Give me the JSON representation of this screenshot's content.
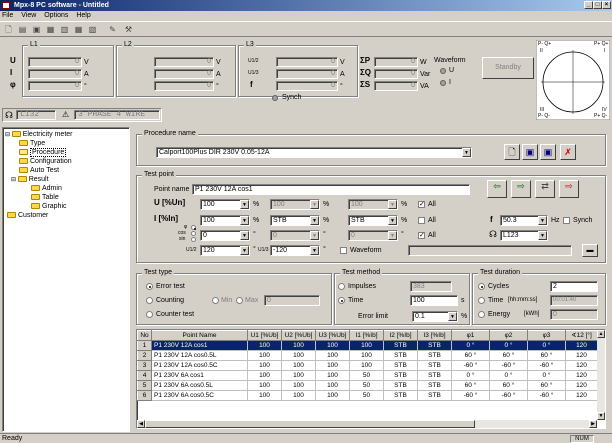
{
  "window": {
    "title": "Mpx-8 PC software - Untitled"
  },
  "menu": [
    "File",
    "View",
    "Options",
    "Help"
  ],
  "meter": {
    "L1": "L1",
    "L2": "L2",
    "L3": "L3",
    "row_labels": [
      "U",
      "I",
      "φ"
    ],
    "units": [
      "V",
      "A",
      "°"
    ],
    "zero": "0",
    "sum_labels": [
      "ΣP",
      "ΣQ",
      "ΣS"
    ],
    "sum_units": [
      "W",
      "Var",
      "VA"
    ],
    "mid_labels": [
      "U1/2",
      "U1/3",
      "f"
    ],
    "mid_units": [
      "°",
      "°",
      "Hz"
    ],
    "synch": "Synch",
    "waveform": "Waveform",
    "wave_u": "U",
    "wave_i": "I",
    "standby": "Standby",
    "phase_seq": "L132",
    "mode": "3 PHASE 4 WIRE",
    "phasor": {
      "q1": "P- Q+",
      "q1r": "P+ Q+",
      "II": "II",
      "I": "I",
      "III": "III",
      "IV": "IV",
      "q3": "P- Q-",
      "q4": "P+ Q-"
    }
  },
  "tree": [
    "Electricity meter",
    "Type",
    "Procedure",
    "Configuration",
    "Auto Test",
    "Result",
    "Admin",
    "Table",
    "Graphic",
    "Customer"
  ],
  "procedure": {
    "label": "Procedure name",
    "value": "Calport100Plus DIR 230V 0.05-12A"
  },
  "testpoint": {
    "label": "Test point",
    "point_name_label": "Point name",
    "point_name": "P1 230V 12A cos1",
    "u_label": "U [%Un]",
    "i_label": "I [%In]",
    "u_val": "100",
    "u2": "100",
    "u3": "100",
    "i_val": "100",
    "i2": "STB",
    "i3": "STB",
    "pct": "%",
    "all": "All",
    "cos_val": "0",
    "cos2": "0",
    "cos3": "0",
    "phi_label": "φ",
    "cos_label": "cos",
    "sin_label": "sin",
    "u12_label": "U1/2",
    "u13_label": "U1/3",
    "u12": "120",
    "u13": "-120",
    "waveform": "Waveform",
    "f_label": "f",
    "f_val": "50.3",
    "f_unit": "Hz",
    "synch": "Synch",
    "seq": "L123",
    "deg": "°"
  },
  "testtype": {
    "label": "Test type",
    "error": "Error test",
    "counting": "Counting",
    "min": "Min",
    "max": "Max",
    "maxv": "0",
    "counter": "Counter test"
  },
  "method": {
    "label": "Test method",
    "impulses": "Impulses",
    "imp_val": "383",
    "time": "Time",
    "time_val": "100",
    "s": "s",
    "err_limit": "Error limit",
    "err_val": "0.1",
    "pct": "%"
  },
  "duration": {
    "label": "Test duration",
    "cycles": "Cycles",
    "cycles_val": "2",
    "time": "Time",
    "time_fmt": "[hh:mm:ss]",
    "time_val": "00:01:40",
    "energy": "Energy",
    "kwh": "[kWh]",
    "kwh_val": "0"
  },
  "table": {
    "headers": [
      "No",
      "Point Name",
      "U1 [%Ub]",
      "U2 [%Ub]",
      "U3 [%Ub]",
      "I1 [%Ib]",
      "I2 [%Ib]",
      "I3 [%Ib]",
      "φ1",
      "φ2",
      "φ3",
      "∢12 [°]"
    ],
    "rows": [
      [
        "1",
        "P1 230V 12A cos1",
        "100",
        "100",
        "100",
        "100",
        "STB",
        "STB",
        "0 °",
        "0 °",
        "0 °",
        "120"
      ],
      [
        "2",
        "P1 230V 12A cos0.5L",
        "100",
        "100",
        "100",
        "100",
        "STB",
        "STB",
        "60 °",
        "60 °",
        "60 °",
        "120"
      ],
      [
        "3",
        "P1 230V 12A cos0.5C",
        "100",
        "100",
        "100",
        "100",
        "STB",
        "STB",
        "-60 °",
        "-60 °",
        "-60 °",
        "120"
      ],
      [
        "4",
        "P1 230V 6A cos1",
        "100",
        "100",
        "100",
        "50",
        "STB",
        "STB",
        "0 °",
        "0 °",
        "0 °",
        "120"
      ],
      [
        "5",
        "P1 230V 6A cos0.5L",
        "100",
        "100",
        "100",
        "50",
        "STB",
        "STB",
        "60 °",
        "60 °",
        "60 °",
        "120"
      ],
      [
        "6",
        "P1 230V 6A cos0.5C",
        "100",
        "100",
        "100",
        "50",
        "STB",
        "STB",
        "-60 °",
        "-60 °",
        "-60 °",
        "120"
      ]
    ]
  },
  "status": {
    "left": "Ready",
    "num": "NUM"
  }
}
